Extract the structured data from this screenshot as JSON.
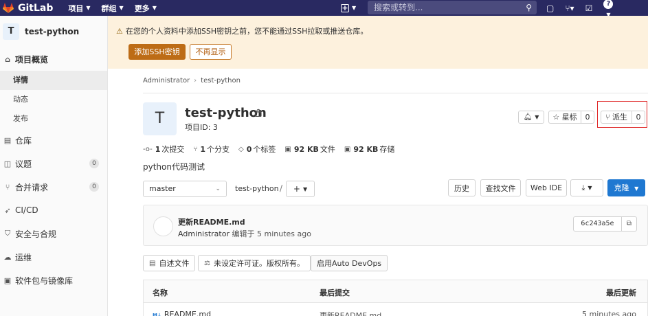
{
  "navbar": {
    "brand": "GitLab",
    "menu": [
      "项目",
      "群组",
      "更多"
    ],
    "search_placeholder": "搜索或转到..."
  },
  "sidebar": {
    "project_avatar": "T",
    "project_name": "test-python",
    "items": [
      {
        "label": "项目概览"
      },
      {
        "label": "仓库"
      },
      {
        "label": "议题",
        "count": "0"
      },
      {
        "label": "合并请求",
        "count": "0"
      },
      {
        "label": "CI/CD"
      },
      {
        "label": "安全与合规"
      },
      {
        "label": "运维"
      },
      {
        "label": "软件包与镜像库"
      }
    ],
    "sub_items": [
      "详情",
      "动态",
      "发布"
    ]
  },
  "alert": {
    "message": "在您的个人资料中添加SSH密钥之前，您不能通过SSH拉取或推送仓库。",
    "add_ssh_label": "添加SSH密钥",
    "dismiss_label": "不再显示"
  },
  "breadcrumb": [
    "Administrator",
    "test-python"
  ],
  "project": {
    "avatar": "T",
    "title": "test-python",
    "id_text": "项目ID: 3",
    "star_label": "星标",
    "star_count": "0",
    "fork_label": "派生",
    "fork_count": "0",
    "description": "python代码测试"
  },
  "stats": [
    {
      "value": "1",
      "label": "次提交"
    },
    {
      "value": "1",
      "label": "个分支"
    },
    {
      "value": "0",
      "label": "个标签"
    },
    {
      "value": "92 KB",
      "label": "文件"
    },
    {
      "value": "92 KB",
      "label": "存储"
    }
  ],
  "repo": {
    "branch": "master",
    "path": "test-python",
    "path_sep": "/",
    "history_label": "历史",
    "find_file_label": "查找文件",
    "web_ide_label": "Web IDE",
    "clone_label": "克隆"
  },
  "commit": {
    "message": "更新README.md",
    "author": "Administrator",
    "action": "编辑于",
    "time": "5 minutes ago",
    "sha": "6c243a5e"
  },
  "quick_actions": [
    "自述文件",
    "未设定许可证。版权所有。",
    "启用Auto DevOps"
  ],
  "table": {
    "headers": [
      "名称",
      "最后提交",
      "最后更新"
    ],
    "rows": [
      {
        "name": "README.md",
        "commit": "更新README.md",
        "updated": "5 minutes ago"
      }
    ]
  }
}
